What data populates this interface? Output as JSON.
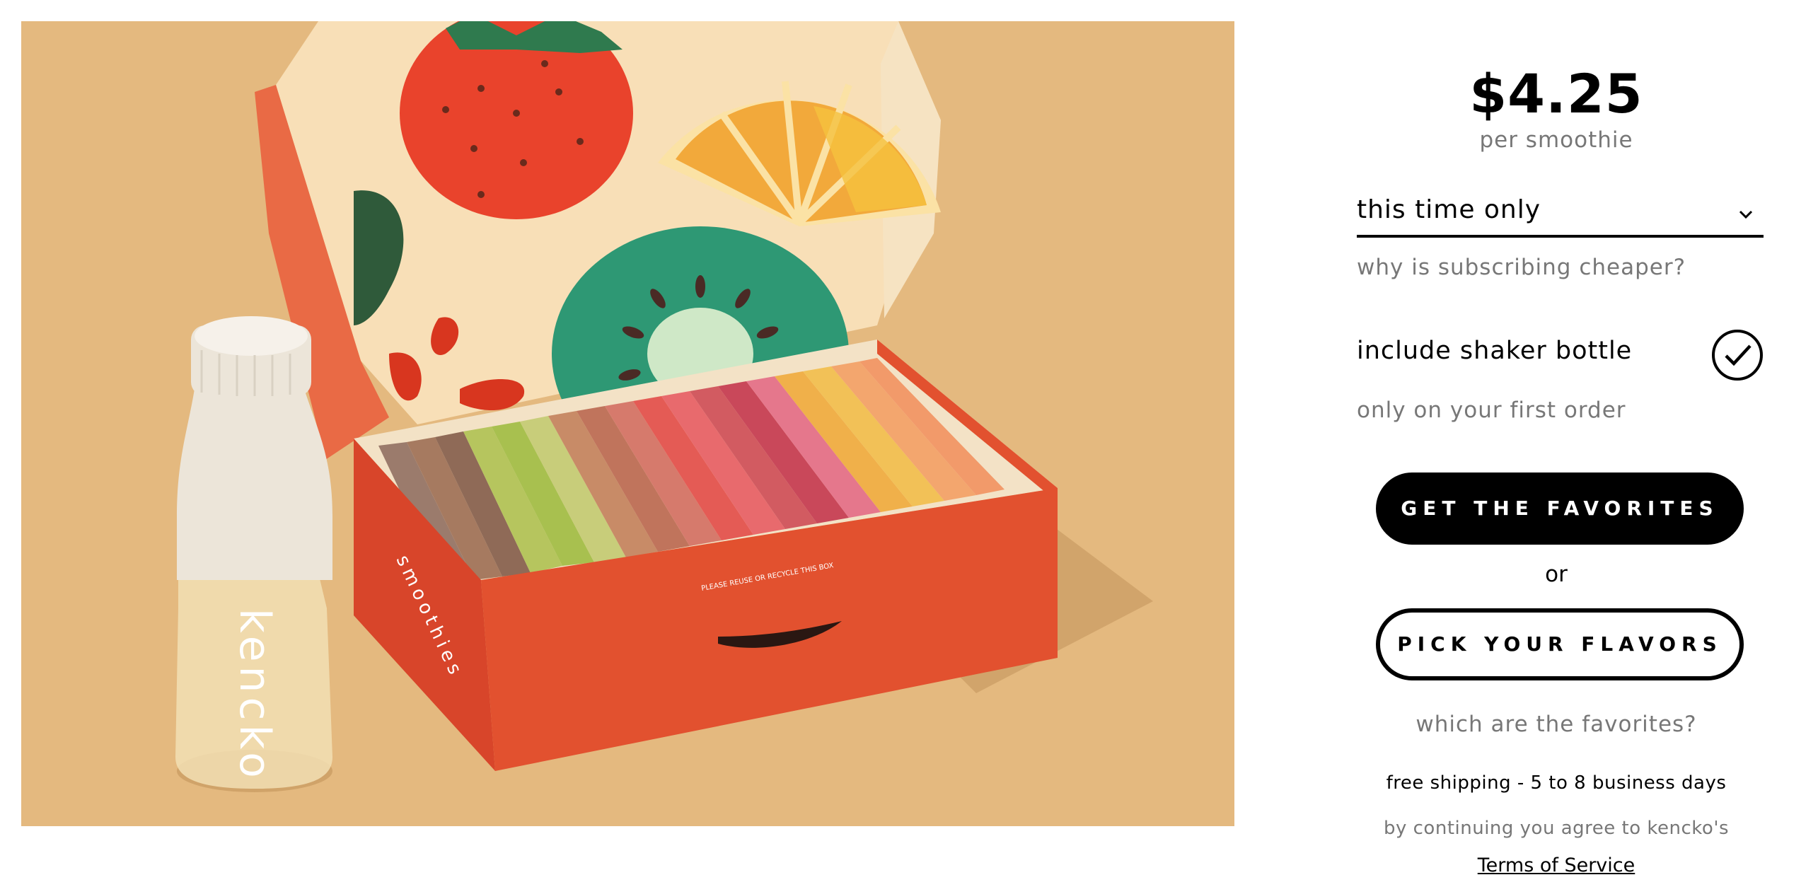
{
  "product_image": {
    "alt": "Kencko smoothie box with shaker bottle",
    "bottle_lettering": "kencko",
    "box_side_lettering": "smoothies",
    "box_front_lettering": "PLEASE REUSE OR RECYCLE THIS BOX",
    "colors": {
      "background": "#e4b97f",
      "box": "#e2512f",
      "box_lid_inside": "#f8dfb7",
      "strawberry": "#e9432c",
      "kiwi": "#2e9874",
      "orange_slice": "#f2a93b",
      "bottle_cap": "#ede7dc"
    }
  },
  "pricing": {
    "price": "$4.25",
    "unit": "per smoothie"
  },
  "frequency": {
    "selected": "this time only",
    "help_link": "why is subscribing cheaper?"
  },
  "shaker": {
    "label": "include shaker bottle",
    "checked": true,
    "note": "only on your first order"
  },
  "actions": {
    "primary_label": "GET THE FAVORITES",
    "separator": "or",
    "secondary_label": "PICK YOUR FLAVORS",
    "favorites_link": "which are the favorites?"
  },
  "footer": {
    "shipping": "free shipping - 5 to 8 business days",
    "agree": "by continuing you agree to kencko's",
    "tos_link": "Terms of Service"
  }
}
